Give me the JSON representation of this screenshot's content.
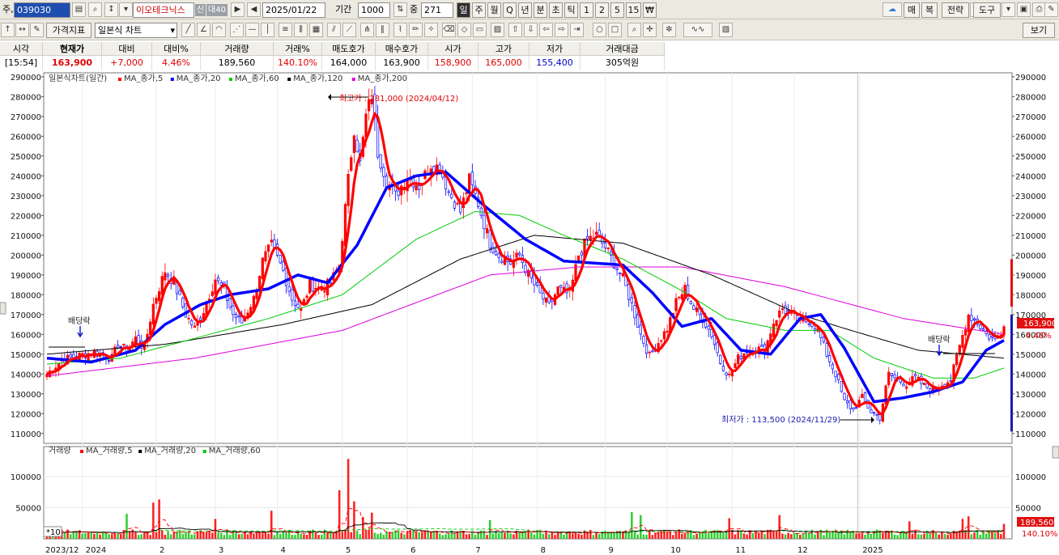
{
  "toolbar1": {
    "type_label": "주,",
    "code": "039030",
    "name": "이오테크닉스",
    "badge1": "신",
    "badge2": "대40",
    "date": "2025/01/22",
    "period_label": "기간",
    "period_value": "1000",
    "count_label": "중",
    "count_value": "271",
    "units": [
      "일",
      "주",
      "월",
      "Q",
      "년",
      "분",
      "초",
      "틱",
      "1",
      "2",
      "5",
      "15",
      "₩"
    ],
    "right_buttons": [
      "매",
      "복",
      "전략",
      "도구"
    ]
  },
  "toolbar2": {
    "indicator_button": "가격지표",
    "chart_type": "일본식 차트",
    "view_button": "보기"
  },
  "info": {
    "headers": [
      "시각",
      "현재가",
      "대비",
      "대비%",
      "거래량",
      "거래%",
      "매도호가",
      "매수호가",
      "시가",
      "고가",
      "저가",
      "거래대금"
    ],
    "values": [
      "[15:54]",
      "163,900",
      "+7,000",
      "4.46%",
      "189,560",
      "140.10%",
      "164,000",
      "163,900",
      "158,900",
      "165,000",
      "155,400",
      "305억원"
    ]
  },
  "colors": {
    "up": "#ff0000",
    "down": "#0000ff",
    "ma5": "#ff0000",
    "ma20": "#0000ff",
    "ma60": "#00cc00",
    "ma120": "#000000",
    "ma200": "#dd00dd",
    "vol_up": "#ff2020",
    "vol_down": "#33cc33"
  },
  "chart_data": {
    "type": "candlestick",
    "title": "일본식차트(일간)",
    "legend": [
      {
        "name": "MA_종가,5",
        "color": "#ff0000"
      },
      {
        "name": "MA_종가,20",
        "color": "#0000ff"
      },
      {
        "name": "MA_종가,60",
        "color": "#00cc00"
      },
      {
        "name": "MA_종가,120",
        "color": "#000000"
      },
      {
        "name": "MA_종가,200",
        "color": "#dd00dd"
      }
    ],
    "y_ticks": [
      290000,
      280000,
      270000,
      260000,
      250000,
      240000,
      230000,
      220000,
      210000,
      200000,
      190000,
      180000,
      170000,
      160000,
      150000,
      140000,
      130000,
      120000,
      110000
    ],
    "ylim": [
      105000,
      292000
    ],
    "x_ticks": [
      "2023/12",
      "2024",
      "2",
      "3",
      "4",
      "5",
      "6",
      "7",
      "8",
      "9",
      "10",
      "11",
      "12",
      "2025"
    ],
    "current_price": "163,900",
    "current_change": "4.46%",
    "annotations": {
      "high": "최고가 : 281,000 (2024/04/12)",
      "low": "최저가 : 113,500 (2024/11/29)",
      "dividend_1": "배당락",
      "dividend_2": "배당락"
    },
    "close_path": [
      [
        0,
        140000
      ],
      [
        5,
        147000
      ],
      [
        10,
        149000
      ],
      [
        16,
        151000
      ],
      [
        22,
        148000
      ],
      [
        24,
        155000
      ],
      [
        27,
        152000
      ],
      [
        30,
        158000
      ],
      [
        33,
        153000
      ],
      [
        36,
        175000
      ],
      [
        40,
        192000
      ],
      [
        43,
        186000
      ],
      [
        47,
        170000
      ],
      [
        50,
        163000
      ],
      [
        53,
        172000
      ],
      [
        57,
        188000
      ],
      [
        60,
        182000
      ],
      [
        63,
        170000
      ],
      [
        66,
        166000
      ],
      [
        70,
        178000
      ],
      [
        73,
        197000
      ],
      [
        76,
        205000
      ],
      [
        80,
        192000
      ],
      [
        83,
        178000
      ],
      [
        86,
        172000
      ],
      [
        89,
        185000
      ],
      [
        93,
        183000
      ],
      [
        96,
        186000
      ],
      [
        99,
        195000
      ],
      [
        102,
        238000
      ],
      [
        104,
        264000
      ],
      [
        106,
        246000
      ],
      [
        108,
        270000
      ],
      [
        110,
        281000
      ],
      [
        112,
        252000
      ],
      [
        115,
        238000
      ],
      [
        118,
        230000
      ],
      [
        122,
        240000
      ],
      [
        126,
        235000
      ],
      [
        130,
        246000
      ],
      [
        133,
        244000
      ],
      [
        136,
        232000
      ],
      [
        140,
        222000
      ],
      [
        143,
        238000
      ],
      [
        146,
        226000
      ],
      [
        150,
        206000
      ],
      [
        153,
        200000
      ],
      [
        157,
        196000
      ],
      [
        160,
        200000
      ],
      [
        163,
        190000
      ],
      [
        167,
        180000
      ],
      [
        170,
        174000
      ],
      [
        173,
        183000
      ],
      [
        177,
        180000
      ],
      [
        180,
        200000
      ],
      [
        183,
        208000
      ],
      [
        186,
        210000
      ],
      [
        189,
        204000
      ],
      [
        192,
        196000
      ],
      [
        195,
        188000
      ],
      [
        198,
        175000
      ],
      [
        201,
        160000
      ],
      [
        204,
        149000
      ],
      [
        207,
        156000
      ],
      [
        210,
        163000
      ],
      [
        213,
        176000
      ],
      [
        216,
        183000
      ],
      [
        219,
        173000
      ],
      [
        222,
        168000
      ],
      [
        225,
        160000
      ],
      [
        228,
        146000
      ],
      [
        231,
        139000
      ],
      [
        234,
        148000
      ],
      [
        237,
        152000
      ],
      [
        240,
        153000
      ],
      [
        243,
        152000
      ],
      [
        246,
        166000
      ],
      [
        249,
        173000
      ],
      [
        252,
        170000
      ],
      [
        255,
        166000
      ],
      [
        258,
        167000
      ],
      [
        261,
        162000
      ],
      [
        264,
        150000
      ],
      [
        267,
        140000
      ],
      [
        270,
        126000
      ],
      [
        273,
        122000
      ],
      [
        276,
        128000
      ],
      [
        279,
        121000
      ],
      [
        282,
        118000
      ],
      [
        285,
        140000
      ],
      [
        288,
        137000
      ],
      [
        291,
        135000
      ],
      [
        294,
        138000
      ],
      [
        297,
        134000
      ],
      [
        300,
        132000
      ],
      [
        303,
        135000
      ],
      [
        306,
        137000
      ],
      [
        309,
        154000
      ],
      [
        312,
        170000
      ],
      [
        315,
        166000
      ],
      [
        318,
        160000
      ],
      [
        321,
        157000
      ],
      [
        324,
        163900
      ]
    ],
    "ma20_path": [
      [
        0,
        148000
      ],
      [
        15,
        146000
      ],
      [
        30,
        152000
      ],
      [
        40,
        165000
      ],
      [
        52,
        175000
      ],
      [
        62,
        180000
      ],
      [
        75,
        183000
      ],
      [
        85,
        190000
      ],
      [
        95,
        186000
      ],
      [
        105,
        205000
      ],
      [
        115,
        234000
      ],
      [
        125,
        240000
      ],
      [
        135,
        242000
      ],
      [
        148,
        225000
      ],
      [
        162,
        208000
      ],
      [
        175,
        197000
      ],
      [
        185,
        196000
      ],
      [
        195,
        195000
      ],
      [
        205,
        181000
      ],
      [
        215,
        164000
      ],
      [
        225,
        168000
      ],
      [
        235,
        152000
      ],
      [
        245,
        150000
      ],
      [
        255,
        168000
      ],
      [
        262,
        170000
      ],
      [
        270,
        153000
      ],
      [
        280,
        126000
      ],
      [
        290,
        128000
      ],
      [
        300,
        131000
      ],
      [
        310,
        136000
      ],
      [
        318,
        152000
      ],
      [
        324,
        157000
      ]
    ],
    "ma60_path": [
      [
        0,
        145000
      ],
      [
        25,
        148000
      ],
      [
        50,
        158000
      ],
      [
        75,
        168000
      ],
      [
        100,
        180000
      ],
      [
        125,
        208000
      ],
      [
        145,
        222000
      ],
      [
        160,
        220000
      ],
      [
        175,
        210000
      ],
      [
        195,
        198000
      ],
      [
        215,
        182000
      ],
      [
        230,
        168000
      ],
      [
        250,
        162000
      ],
      [
        265,
        162000
      ],
      [
        280,
        148000
      ],
      [
        300,
        138000
      ],
      [
        314,
        138000
      ],
      [
        324,
        143000
      ]
    ],
    "ma120_path": [
      [
        0,
        150000
      ],
      [
        40,
        155000
      ],
      [
        80,
        165000
      ],
      [
        110,
        175000
      ],
      [
        140,
        198000
      ],
      [
        165,
        210000
      ],
      [
        195,
        206000
      ],
      [
        225,
        190000
      ],
      [
        255,
        170000
      ],
      [
        270,
        163000
      ],
      [
        295,
        152000
      ],
      [
        324,
        148000
      ]
    ],
    "ma200_path": [
      [
        0,
        139000
      ],
      [
        50,
        148000
      ],
      [
        100,
        162000
      ],
      [
        150,
        190000
      ],
      [
        180,
        194000
      ],
      [
        215,
        194000
      ],
      [
        250,
        184000
      ],
      [
        290,
        168000
      ],
      [
        324,
        160000
      ]
    ],
    "volume": {
      "title": "거래량",
      "legend": [
        {
          "name": "MA_거래량,5",
          "color": "#ff0000"
        },
        {
          "name": "MA_거래량,20",
          "color": "#000000"
        },
        {
          "name": "MA_거래량,60",
          "color": "#00cc00"
        }
      ],
      "y_ticks": [
        100000,
        50000
      ],
      "multiplier": "*10",
      "last_volume": "189,560",
      "last_ratio": "140.10%",
      "ylim": [
        0,
        140000
      ],
      "base": 10000,
      "spikes": [
        [
          27,
          40000
        ],
        [
          36,
          58000
        ],
        [
          38,
          63000
        ],
        [
          57,
          32000
        ],
        [
          76,
          45000
        ],
        [
          99,
          78000
        ],
        [
          102,
          128000
        ],
        [
          104,
          60000
        ],
        [
          107,
          35000
        ],
        [
          110,
          42000
        ],
        [
          150,
          30000
        ],
        [
          198,
          43000
        ],
        [
          201,
          38000
        ],
        [
          231,
          33000
        ],
        [
          248,
          38000
        ],
        [
          292,
          28000
        ],
        [
          310,
          32000
        ],
        [
          312,
          36000
        ],
        [
          324,
          24000
        ]
      ]
    }
  }
}
